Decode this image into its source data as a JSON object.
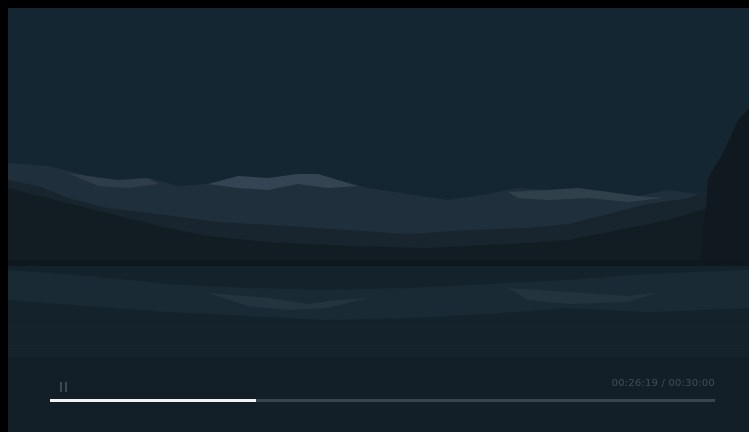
{
  "player": {
    "current_time": "00:26:19",
    "separator": "/",
    "duration": "00:30:00",
    "progress_fraction": 0.31,
    "state": "playing",
    "pause_icon": "pause-icon"
  },
  "colors": {
    "sky": "#152734",
    "mountains": "#1b2a36",
    "snow": "#3c4c5a",
    "water": "#14232d",
    "progress_fill": "#f2f2f2",
    "progress_track": "#39464f"
  }
}
